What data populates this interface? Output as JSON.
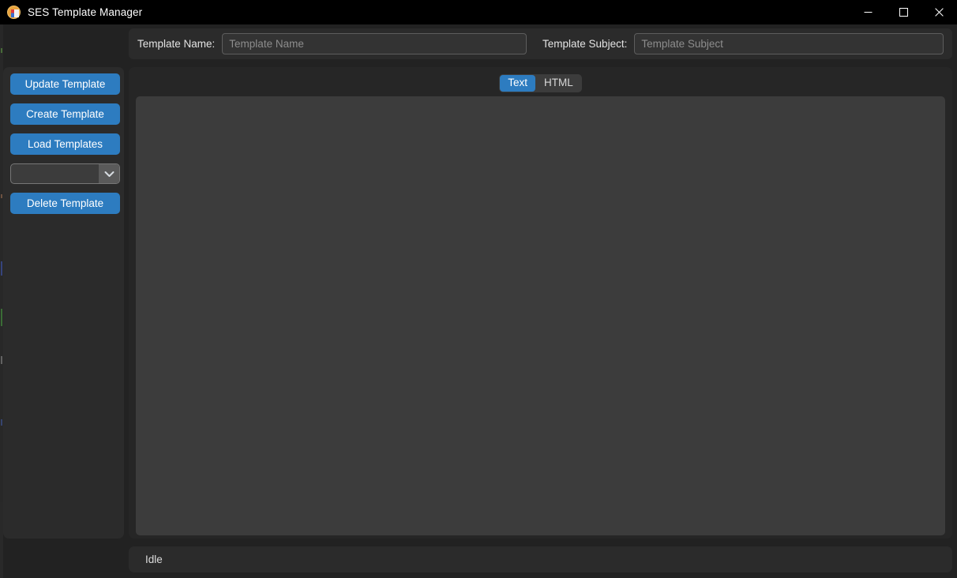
{
  "window": {
    "title": "SES Template Manager",
    "icon": "app-template-icon",
    "controls": {
      "minimize": "minimize-icon",
      "maximize": "maximize-icon",
      "close": "close-icon"
    }
  },
  "topbar": {
    "name_label": "Template Name:",
    "name_value": "",
    "name_placeholder": "Template Name",
    "subject_label": "Template Subject:",
    "subject_value": "",
    "subject_placeholder": "Template Subject"
  },
  "sidebar": {
    "buttons": [
      {
        "label": "Update Template"
      },
      {
        "label": "Create Template"
      },
      {
        "label": "Load Templates"
      }
    ],
    "dropdown": {
      "value": "",
      "arrow_icon": "chevron-down-icon"
    },
    "delete_button": {
      "label": "Delete Template"
    }
  },
  "main": {
    "tabs": [
      {
        "label": "Text",
        "active": true
      },
      {
        "label": "HTML",
        "active": false
      }
    ],
    "editor": {
      "value": "",
      "placeholder": ""
    }
  },
  "statusbar": {
    "text": "Idle"
  },
  "colors": {
    "accent": "#2d7cc0",
    "window_bg": "#222222",
    "panel_bg": "#2b2b2b",
    "content_bg": "#262626",
    "editor_bg": "#3c3c3c",
    "titlebar_bg": "#000000",
    "text": "#e4e4e4",
    "placeholder": "#8d8d8d"
  }
}
